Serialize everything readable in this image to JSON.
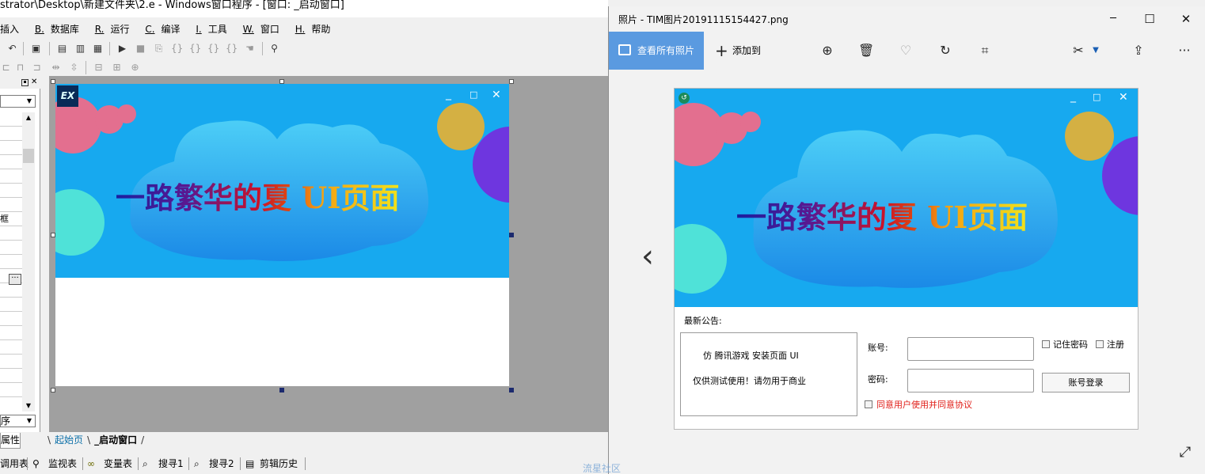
{
  "ide": {
    "title": "strator\\Desktop\\新建文件夹\\2.e - Windows窗口程序 - [窗口: _启动窗口]",
    "menu": [
      {
        "key": "",
        "label": "插入"
      },
      {
        "key": "B.",
        "label": "数据库"
      },
      {
        "key": "R.",
        "label": "运行"
      },
      {
        "key": "C.",
        "label": "编译"
      },
      {
        "key": "I.",
        "label": "工具"
      },
      {
        "key": "W.",
        "label": "窗口"
      },
      {
        "key": "H.",
        "label": "帮助"
      }
    ],
    "prop_row_label": "框",
    "prop_sort_label": "序",
    "prop_tab": "属性",
    "doc_tabs": [
      "起始页",
      "_启动窗口"
    ],
    "bottom_tabs": [
      "调用表",
      "监视表",
      "变量表",
      "搜寻1",
      "搜寻2",
      "剪辑历史"
    ],
    "watermark": "流星社区"
  },
  "photos": {
    "title": "照片 - TIM图片20191115154427.png",
    "view_all": "查看所有照片",
    "add_to": "添加到"
  },
  "preview": {
    "banner_text": "一路繁华的夏 UI页面",
    "notice_title": "最新公告:",
    "notice_line1": "仿 腾讯游戏 安装页面 UI",
    "notice_line2": "仅供测试使用！请勿用于商业",
    "account_label": "账号:",
    "password_label": "密码:",
    "remember": "记住密码",
    "register": "注册",
    "login_button": "账号登录",
    "agree": "同意用户使用并同意协议",
    "agree_color": "#e0201a"
  },
  "colors": {
    "banner_bg": "#17a9ef",
    "accent": "#5a9ae0"
  }
}
